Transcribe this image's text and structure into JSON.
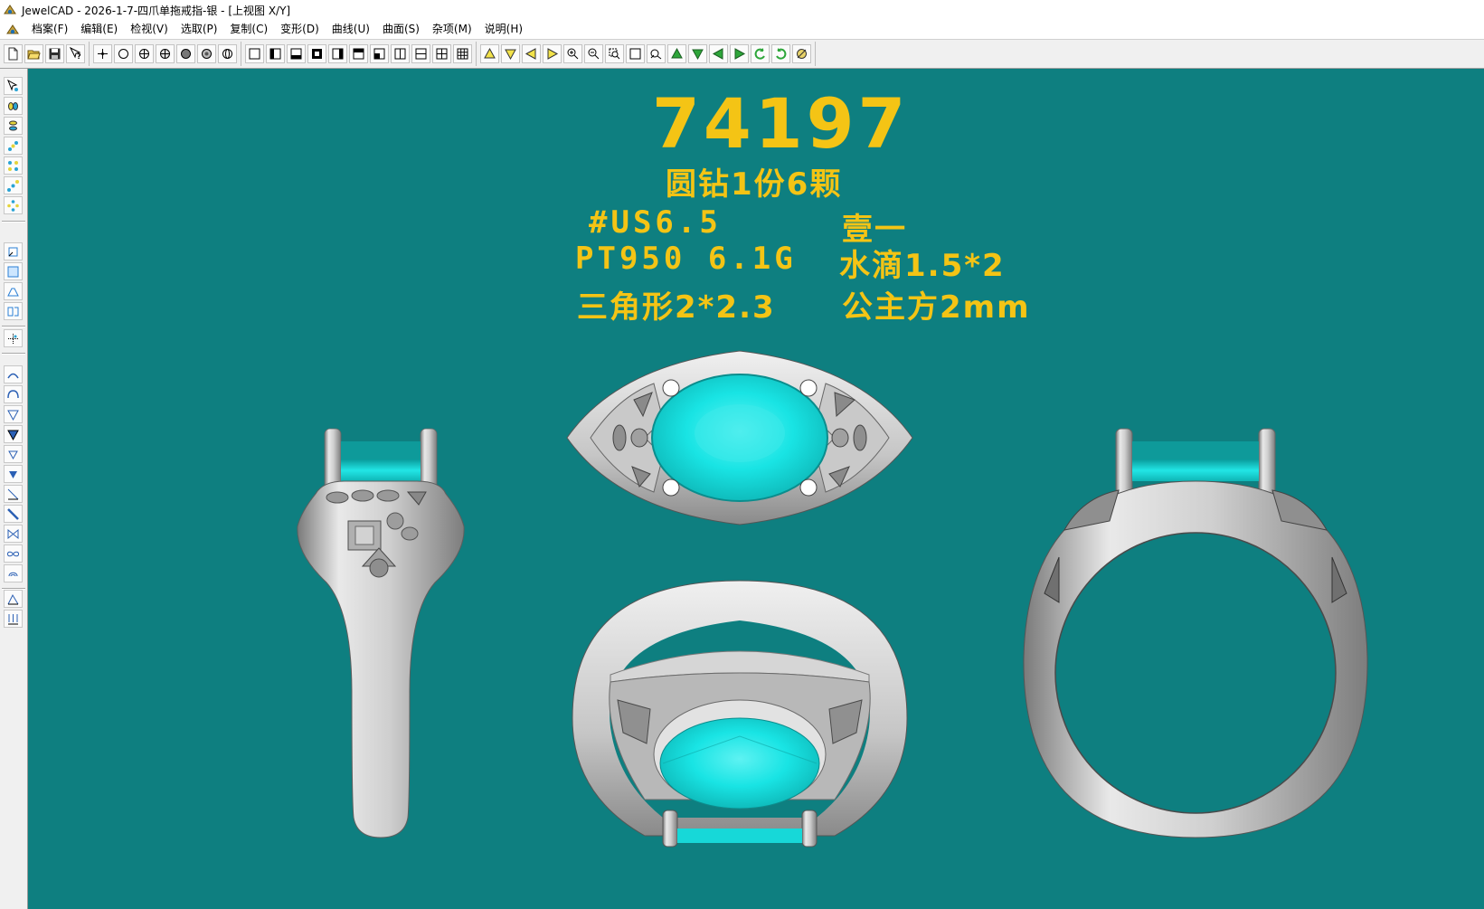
{
  "window": {
    "title": "JewelCAD - 2026-1-7-四爪单拖戒指-银 - [上视图 X/Y]"
  },
  "menu": [
    {
      "label": "档案(F)"
    },
    {
      "label": "编辑(E)"
    },
    {
      "label": "检视(V)"
    },
    {
      "label": "选取(P)"
    },
    {
      "label": "复制(C)"
    },
    {
      "label": "变形(D)"
    },
    {
      "label": "曲线(U)"
    },
    {
      "label": "曲面(S)"
    },
    {
      "label": "杂项(M)"
    },
    {
      "label": "说明(H)"
    }
  ],
  "annotations": {
    "model_number": "74197",
    "stone_summary": "圆钻1份6颗",
    "ring_size": "#US6.5",
    "engraving": "壹一",
    "metal_weight": "PT950 6.1G",
    "pear_stone": "水滴1.5*2",
    "triangle_stone": "三角形2*2.3",
    "princess_stone": "公主方2mm"
  },
  "colors": {
    "viewport_bg": "#0e7f80",
    "annotation_text": "#f4c415",
    "gem": "#19e4e4",
    "metal": "#d6d6d6"
  },
  "icons": {
    "toolbar": [
      "new-file-icon",
      "open-file-icon",
      "save-icon",
      "help-pointer-icon",
      "snap-point-icon",
      "circle-icon",
      "target-icon",
      "crosshair-circle-icon",
      "filled-circle-icon",
      "shaded-circle-icon",
      "wire-sphere-icon",
      "view-box-icon",
      "view-left-icon",
      "view-bottom-icon",
      "view-full-icon",
      "view-right-icon",
      "view-top-icon",
      "view-corner-icon",
      "split-vertical-icon",
      "split-horizontal-icon",
      "grid-four-icon",
      "grid-nine-icon",
      "arrow-up-icon",
      "arrow-down-icon",
      "arrow-left-icon",
      "arrow-right-icon",
      "zoom-in-icon",
      "zoom-out-icon",
      "zoom-window-icon",
      "zoom-fit-icon",
      "pan-icon",
      "rotate-up-icon",
      "rotate-down-icon",
      "rotate-left-icon",
      "rotate-right-icon",
      "rotate-ccw-icon",
      "rotate-cw-icon",
      "render-icon"
    ],
    "left_toolbar": [
      "select-pointer-icon",
      "select-pair-icon",
      "select-stack-icon",
      "select-chain-icon",
      "select-grid-icon",
      "select-diagonal-icon",
      "select-ring-icon",
      "rect-view-icon",
      "frame-view-icon",
      "profile-view-icon",
      "mirror-view-icon",
      "point-edit-icon",
      "curve-arc-icon",
      "curve-loop-icon",
      "triangle-outline-icon",
      "triangle-fill-icon",
      "triangle-small-icon",
      "triangle-solid-icon",
      "slant-line-icon",
      "slant-bold-icon",
      "bowtie-icon",
      "infinity-icon",
      "spiral-icon",
      "measure-icon",
      "arrow-down-triple-icon"
    ]
  }
}
